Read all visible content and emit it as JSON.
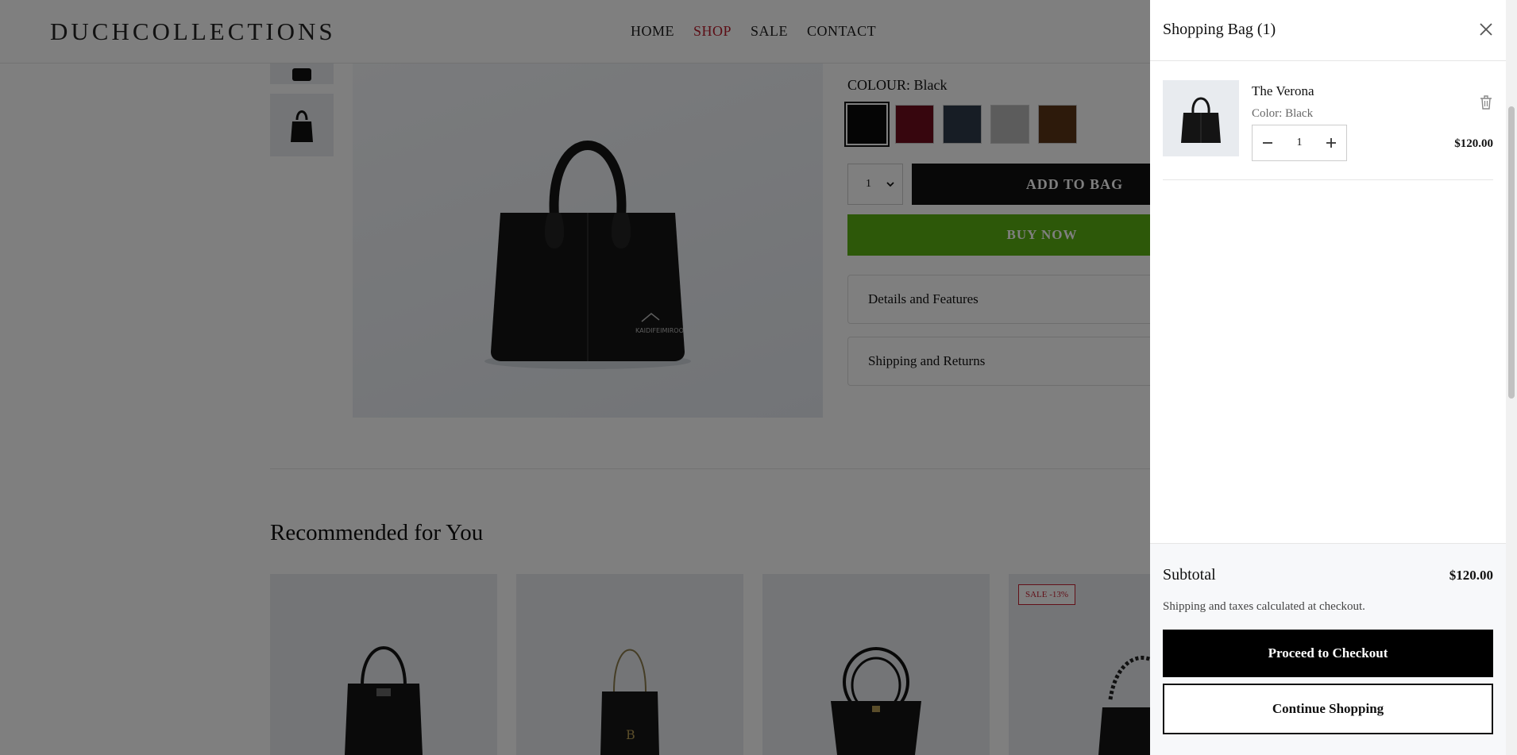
{
  "header": {
    "logo": "DUCHCOLLECTIONS",
    "nav": [
      "HOME",
      "SHOP",
      "SALE",
      "CONTACT"
    ],
    "active_nav": "SHOP"
  },
  "product": {
    "colour_label": "COLOUR:",
    "colour_value": "Black",
    "swatches": [
      {
        "name": "Black",
        "color": "#0b0b0b",
        "selected": true
      },
      {
        "name": "Burgundy",
        "color": "#6e0c1d",
        "selected": false
      },
      {
        "name": "Navy",
        "color": "#2f3a4b",
        "selected": false
      },
      {
        "name": "Grey",
        "color": "#b9b9b9",
        "selected": false
      },
      {
        "name": "Brown",
        "color": "#5a3417",
        "selected": false
      }
    ],
    "quantity": "1",
    "add_to_bag_label": "ADD TO BAG",
    "buy_now_label": "BUY NOW",
    "accordion_details": "Details and Features",
    "accordion_shipping": "Shipping and Returns"
  },
  "recommended": {
    "title": "Recommended for You",
    "sale_badge": "SALE -13%"
  },
  "cart": {
    "title": "Shopping Bag (1)",
    "item": {
      "name": "The Verona",
      "color_label": "Color: Black",
      "quantity": "1",
      "price": "$120.00"
    },
    "subtotal_label": "Subtotal",
    "subtotal_value": "$120.00",
    "shipping_note": "Shipping and taxes calculated at checkout.",
    "checkout_label": "Proceed to Checkout",
    "continue_label": "Continue Shopping"
  },
  "colors": {
    "accent_red": "#b81b2b",
    "buy_now_green": "#5bb012",
    "overlay": "rgba(0,0,0,0.5)"
  }
}
